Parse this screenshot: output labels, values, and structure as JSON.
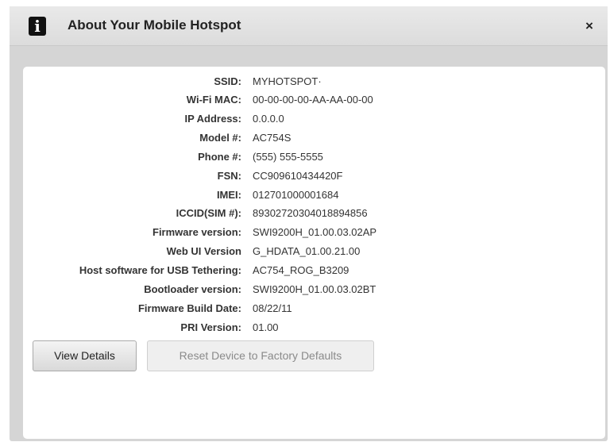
{
  "dialog": {
    "title": "About Your Mobile Hotspot",
    "close_label": "×",
    "info_icon_glyph": "i"
  },
  "details": [
    {
      "label": "SSID:",
      "value": "MYHOTSPOT·"
    },
    {
      "label": "Wi-Fi MAC:",
      "value": "00-00-00-00-AA-AA-00-00"
    },
    {
      "label": "IP Address:",
      "value": "0.0.0.0"
    },
    {
      "label": "Model #:",
      "value": "AC754S"
    },
    {
      "label": "Phone #:",
      "value": "(555) 555-5555"
    },
    {
      "label": "FSN:",
      "value": "CC909610434420F"
    },
    {
      "label": "IMEI:",
      "value": "012701000001684"
    },
    {
      "label": "ICCID(SIM #):",
      "value": "89302720304018894856"
    },
    {
      "label": "Firmware version:",
      "value": "SWI9200H_01.00.03.02AP"
    },
    {
      "label": "Web UI Version",
      "value": "G_HDATA_01.00.21.00"
    },
    {
      "label": "Host software for USB Tethering:",
      "value": "AC754_ROG_B3209"
    },
    {
      "label": "Bootloader version:",
      "value": "SWI9200H_01.00.03.02BT"
    },
    {
      "label": "Firmware Build Date:",
      "value": "08/22/11"
    },
    {
      "label": "PRI Version:",
      "value": "01.00"
    }
  ],
  "buttons": {
    "view_details": "View Details",
    "reset_device": "Reset Device to Factory Defaults"
  }
}
